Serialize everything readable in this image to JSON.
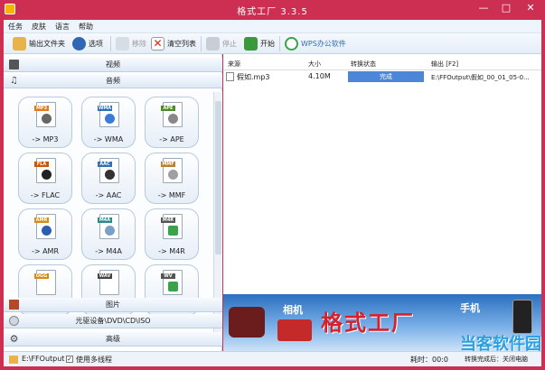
{
  "window": {
    "title": "格式工厂 3.3.5",
    "minimize": "—",
    "maximize": "□",
    "close": "✕"
  },
  "menu": [
    "任务",
    "皮肤",
    "语言",
    "帮助"
  ],
  "toolbar": {
    "output_folder": "输出文件夹",
    "options": "选项",
    "remove": "移除",
    "clear_list": "清空列表",
    "stop": "停止",
    "start": "开始",
    "wps": "WPS办公软件"
  },
  "categories": {
    "video": "视频",
    "audio": "音频",
    "picture": "图片",
    "rom": "光驱设备\\DVD\\CD\\ISO",
    "advanced": "高级"
  },
  "audio_formats": [
    {
      "fmt": "MP3",
      "label": "-> MP3",
      "color": "#e07a1a"
    },
    {
      "fmt": "WMA",
      "label": "-> WMA",
      "color": "#2d6fb8"
    },
    {
      "fmt": "APE",
      "label": "-> APE",
      "color": "#4d8a2a"
    },
    {
      "fmt": "FLA",
      "label": "-> FLAC",
      "color": "#d35400"
    },
    {
      "fmt": "AAC",
      "label": "-> AAC",
      "color": "#2d6fb8"
    },
    {
      "fmt": "MMF",
      "label": "-> MMF",
      "color": "#b97e2a"
    },
    {
      "fmt": "AMR",
      "label": "-> AMR",
      "color": "#d68a1a"
    },
    {
      "fmt": "M4A",
      "label": "-> M4A",
      "color": "#2a8a8a"
    },
    {
      "fmt": "M4R",
      "label": "-> M4R",
      "color": "#555555"
    },
    {
      "fmt": "OGG",
      "label": "",
      "color": "#d68a1a"
    },
    {
      "fmt": "WAV",
      "label": "",
      "color": "#444444"
    },
    {
      "fmt": "WV",
      "label": "",
      "color": "#555555"
    }
  ],
  "table": {
    "headers": {
      "source": "来源",
      "size": "大小",
      "status": "转换状态",
      "output": "输出 [F2]"
    },
    "rows": [
      {
        "source": "假如.mp3",
        "size": "4.10M",
        "status": "完成",
        "output": "E:\\FFOutput\\假如_00_01_05-0..."
      }
    ]
  },
  "banner": {
    "camera": "相机",
    "main": "格式工厂",
    "phone": "手机",
    "watermark": "当客软件园"
  },
  "status": {
    "output_path": "E:\\FFOutput",
    "multithread": "使用多线程",
    "elapsed": "耗时：00:0",
    "done_note": "转换完成后：关闭电脑"
  },
  "colors": {
    "title_bar": "#cc2f52",
    "progress": "#4b86d9",
    "banner_text": "#d8202a"
  }
}
